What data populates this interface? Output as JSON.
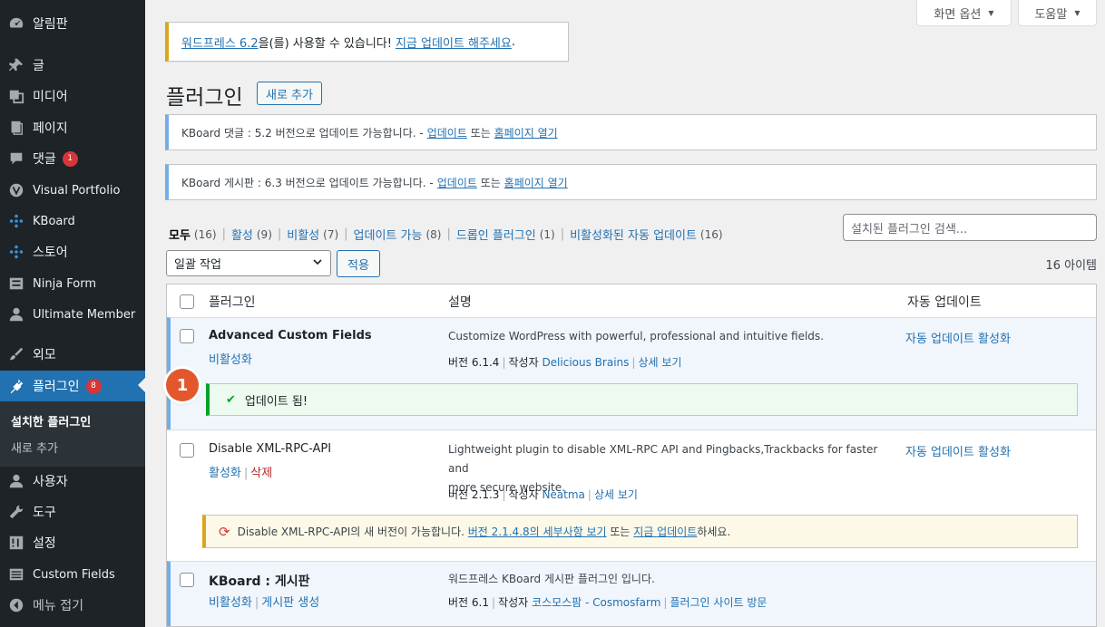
{
  "sidebar": {
    "items": [
      {
        "label": "알림판",
        "icon": "dashboard-icon"
      },
      {
        "label": "글",
        "icon": "pin-icon"
      },
      {
        "label": "미디어",
        "icon": "media-icon"
      },
      {
        "label": "페이지",
        "icon": "page-icon"
      },
      {
        "label": "댓글",
        "icon": "comment-icon",
        "badge": "1"
      },
      {
        "label": "Visual Portfolio",
        "icon": "vp-icon"
      },
      {
        "label": "KBoard",
        "icon": "kboard-icon"
      },
      {
        "label": "스토어",
        "icon": "store-icon"
      },
      {
        "label": "Ninja Form",
        "icon": "form-icon"
      },
      {
        "label": "Ultimate Member",
        "icon": "user-icon"
      },
      {
        "label": "외모",
        "icon": "brush-icon"
      },
      {
        "label": "플러그인",
        "icon": "plugin-icon",
        "badge": "8"
      },
      {
        "label": "사용자",
        "icon": "user-icon"
      },
      {
        "label": "도구",
        "icon": "wrench-icon"
      },
      {
        "label": "설정",
        "icon": "settings-icon"
      },
      {
        "label": "Custom Fields",
        "icon": "fields-icon"
      },
      {
        "label": "메뉴 접기",
        "icon": "collapse-icon"
      }
    ],
    "submenu": {
      "current": "설치한 플러그인",
      "other": "새로 추가"
    }
  },
  "screen_meta": {
    "options_label": "화면 옵션",
    "help_label": "도움말"
  },
  "update_nag": {
    "link1": "워드프레스 6.2",
    "text": "을(를) 사용할 수 있습니다!",
    "link2": "지금 업데이트 해주세요",
    "end": "."
  },
  "page": {
    "title": "플러그인",
    "add_new": "새로 추가"
  },
  "notices": [
    {
      "text": "KBoard 댓글 : 5.2 버전으로 업데이트 가능합니다. - ",
      "link1": "업데이트",
      "mid": " 또는 ",
      "link2": "홈페이지 열기"
    },
    {
      "text": "KBoard 게시판 : 6.3 버전으로 업데이트 가능합니다. - ",
      "link1": "업데이트",
      "mid": " 또는 ",
      "link2": "홈페이지 열기"
    }
  ],
  "filters": [
    {
      "label": "모두",
      "count": "(16)"
    },
    {
      "label": "활성",
      "count": "(9)"
    },
    {
      "label": "비활성",
      "count": "(7)"
    },
    {
      "label": "업데이트 가능",
      "count": "(8)"
    },
    {
      "label": "드롭인 플러그인",
      "count": "(1)"
    },
    {
      "label": "비활성화된 자동 업데이트",
      "count": "(16)"
    }
  ],
  "search": {
    "placeholder": "설치된 플러그인 검색..."
  },
  "bulk": {
    "selected": "일괄 작업",
    "apply": "적용",
    "items_count": "16 아이템"
  },
  "table": {
    "headers": {
      "plugin": "플러그인",
      "description": "설명",
      "auto_update": "자동 업데이트"
    },
    "rows": [
      {
        "name": "Advanced Custom Fields",
        "action1": "비활성화",
        "description": "Customize WordPress with powerful, professional and intuitive fields.",
        "version": "버전 6.1.4",
        "by": "작성자",
        "author": "Delicious Brains",
        "details": "상세 보기",
        "auto_update": "자동 업데이트 활성화",
        "notice": "업데이트 됨!"
      },
      {
        "name": "Disable XML-RPC-API",
        "action1": "활성화",
        "action2": "삭제",
        "description_l1": "Lightweight plugin to disable XML-RPC API and Pingbacks,Trackbacks for faster and",
        "description_l2": "more secure website.",
        "version": "버전 2.1.3",
        "by": "작성자",
        "author": "Neatma",
        "details": "상세 보기",
        "auto_update": "자동 업데이트 활성화",
        "notice_text": "Disable XML-RPC-API의 새 버전이 가능합니다. ",
        "notice_link1": "버전 2.1.4.8의 세부사항 보기",
        "notice_mid": " 또는 ",
        "notice_link2": "지금 업데이트",
        "notice_end": "하세요."
      },
      {
        "name": "KBoard : 게시판",
        "action1": "비활성화",
        "action2": "게시판 생성",
        "description": "워드프레스 KBoard 게시판 플러그인 입니다.",
        "version": "버전 6.1",
        "by": "작성자",
        "author": "코스모스팜 - Cosmosfarm",
        "details": "플러그인 사이트 방문"
      }
    ]
  },
  "step_marker": "1"
}
